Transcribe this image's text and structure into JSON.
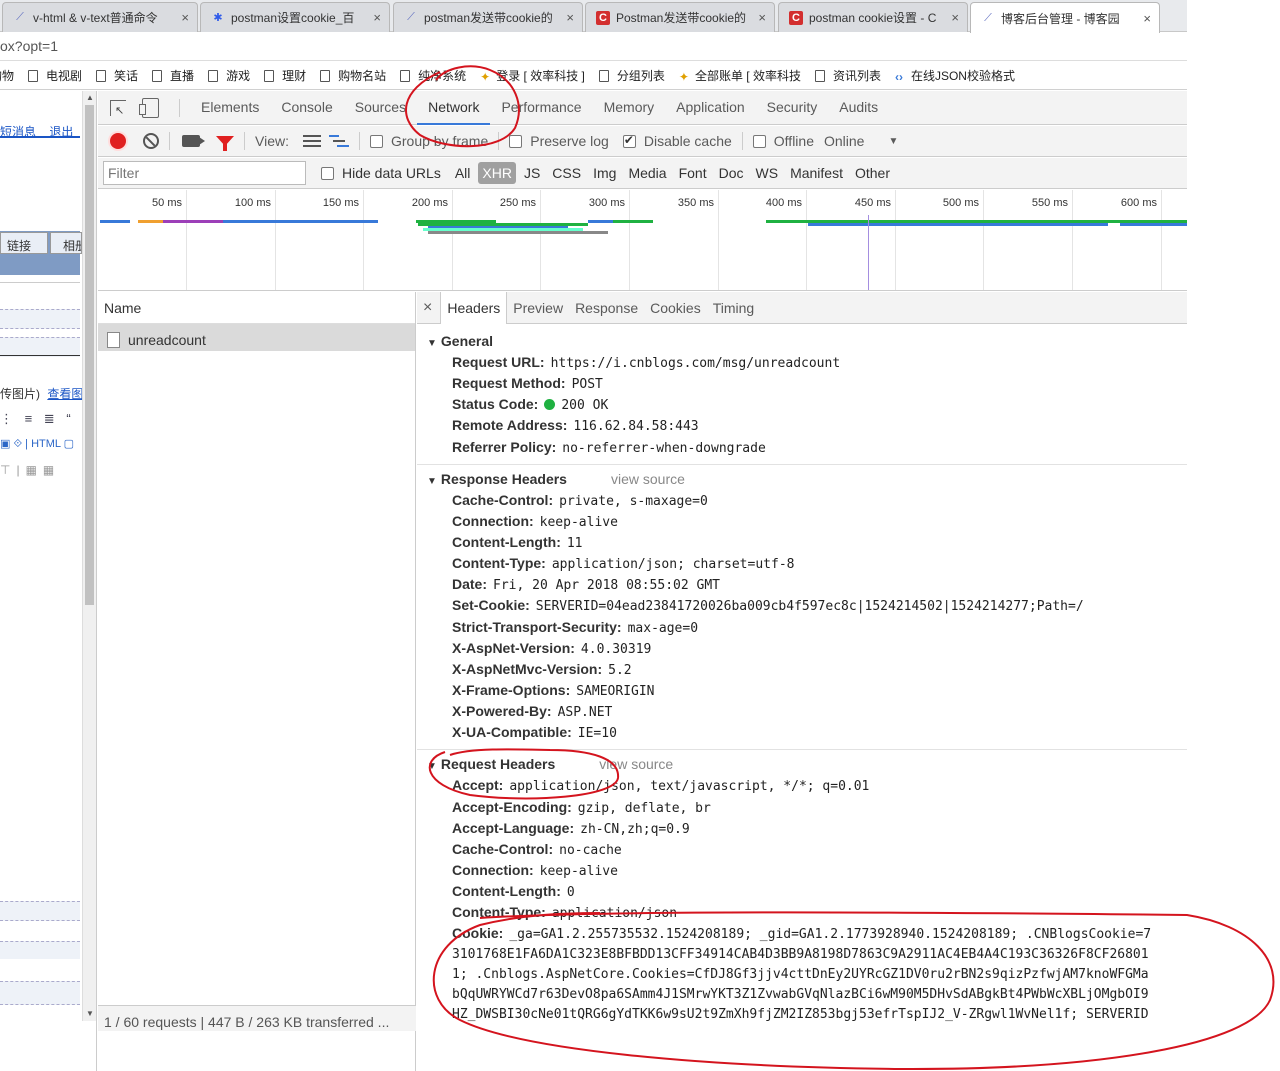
{
  "tabs": [
    {
      "title": "v-html & v-text普通命令",
      "icon": "ruler-icon",
      "icon_color": "#5c6bc0"
    },
    {
      "title": "postman设置cookie_百",
      "icon": "paw-icon",
      "icon_color": "#2f5bea"
    },
    {
      "title": "postman发送带cookie的",
      "icon": "ruler-icon",
      "icon_color": "#5c6bc0"
    },
    {
      "title": "Postman发送带cookie的",
      "icon": "c-logo-icon",
      "icon_color": "#d32f2f"
    },
    {
      "title": "postman cookie设置 - C",
      "icon": "c-logo-icon",
      "icon_color": "#d32f2f"
    },
    {
      "title": "博客后台管理 - 博客园",
      "icon": "ruler-icon",
      "icon_color": "#5c6bc0"
    }
  ],
  "address": "ox?opt=1",
  "bookmarks": [
    {
      "label": "购物",
      "icon": "page"
    },
    {
      "label": "电视剧",
      "icon": "page"
    },
    {
      "label": "笑话",
      "icon": "page"
    },
    {
      "label": "直播",
      "icon": "page"
    },
    {
      "label": "游戏",
      "icon": "page"
    },
    {
      "label": "理财",
      "icon": "page"
    },
    {
      "label": "购物名站",
      "icon": "page"
    },
    {
      "label": "纯净系统",
      "icon": "page"
    },
    {
      "label": "登录 [ 效率科技 ]",
      "icon": "star"
    },
    {
      "label": "分组列表",
      "icon": "page"
    },
    {
      "label": "全部账单 [ 效率科技",
      "icon": "star"
    },
    {
      "label": "资讯列表",
      "icon": "page"
    },
    {
      "label": "在线JSON校验格式",
      "icon": "code"
    }
  ],
  "left_panel": {
    "link1": "短消息",
    "link2": "退出",
    "tab1": "链接",
    "tab2": "相册",
    "upload": "传图片)",
    "view": "查看图"
  },
  "devtools": {
    "tabs": [
      "Elements",
      "Console",
      "Sources",
      "Network",
      "Performance",
      "Memory",
      "Application",
      "Security",
      "Audits"
    ],
    "active_tab": "Network",
    "toolbar": {
      "view": "View:",
      "group_by_frame": "Group by frame",
      "preserve_log": "Preserve log",
      "disable_cache": "Disable cache",
      "offline": "Offline",
      "online": "Online"
    },
    "filter": {
      "placeholder": "Filter",
      "hide_data_urls": "Hide data URLs",
      "types": [
        "All",
        "XHR",
        "JS",
        "CSS",
        "Img",
        "Media",
        "Font",
        "Doc",
        "WS",
        "Manifest",
        "Other"
      ],
      "active_type": "XHR"
    },
    "timeline_ticks": [
      "50 ms",
      "100 ms",
      "150 ms",
      "200 ms",
      "250 ms",
      "300 ms",
      "350 ms",
      "400 ms",
      "450 ms",
      "500 ms",
      "550 ms",
      "600 ms"
    ],
    "name_header": "Name",
    "request_name": "unreadcount",
    "status_bar": "1 / 60 requests  |  447 B / 263 KB transferred  ...",
    "detail_tabs": [
      "Headers",
      "Preview",
      "Response",
      "Cookies",
      "Timing"
    ],
    "active_detail_tab": "Headers",
    "close": "×",
    "view_source": "view source",
    "general": {
      "title": "General",
      "rows": [
        {
          "k": "Request URL:",
          "v": "https://i.cnblogs.com/msg/unreadcount"
        },
        {
          "k": "Request Method:",
          "v": "POST"
        },
        {
          "k": "Status Code:",
          "v": "200 OK"
        },
        {
          "k": "Remote Address:",
          "v": "116.62.84.58:443"
        },
        {
          "k": "Referrer Policy:",
          "v": "no-referrer-when-downgrade"
        }
      ]
    },
    "response_headers": {
      "title": "Response Headers",
      "rows": [
        {
          "k": "Cache-Control:",
          "v": "private, s-maxage=0"
        },
        {
          "k": "Connection:",
          "v": "keep-alive"
        },
        {
          "k": "Content-Length:",
          "v": "11"
        },
        {
          "k": "Content-Type:",
          "v": "application/json; charset=utf-8"
        },
        {
          "k": "Date:",
          "v": "Fri, 20 Apr 2018 08:55:02 GMT"
        },
        {
          "k": "Set-Cookie:",
          "v": "SERVERID=04ead23841720026ba009cb4f597ec8c|1524214502|1524214277;Path=/"
        },
        {
          "k": "Strict-Transport-Security:",
          "v": "max-age=0"
        },
        {
          "k": "X-AspNet-Version:",
          "v": "4.0.30319"
        },
        {
          "k": "X-AspNetMvc-Version:",
          "v": "5.2"
        },
        {
          "k": "X-Frame-Options:",
          "v": "SAMEORIGIN"
        },
        {
          "k": "X-Powered-By:",
          "v": "ASP.NET"
        },
        {
          "k": "X-UA-Compatible:",
          "v": "IE=10"
        }
      ]
    },
    "request_headers": {
      "title": "Request Headers",
      "rows": [
        {
          "k": "Accept:",
          "v": "application/json, text/javascript, */*; q=0.01"
        },
        {
          "k": "Accept-Encoding:",
          "v": "gzip, deflate, br"
        },
        {
          "k": "Accept-Language:",
          "v": "zh-CN,zh;q=0.9"
        },
        {
          "k": "Cache-Control:",
          "v": "no-cache"
        },
        {
          "k": "Connection:",
          "v": "keep-alive"
        },
        {
          "k": "Content-Length:",
          "v": "0"
        },
        {
          "k": "Content-Type:",
          "v": "application/json"
        }
      ],
      "cookie_key": "Cookie:",
      "cookie_lines": [
        "_ga=GA1.2.255735532.1524208189; _gid=GA1.2.1773928940.1524208189; .CNBlogsCookie=7",
        "3101768E1FA6DA1C323E8BFBDD13CFF34914CAB4D3BB9A8198D7863C9A2911AC4EB4A4C193C36326F8CF26801",
        "1; .Cnblogs.AspNetCore.Cookies=CfDJ8Gf3jjv4cttDnEy2UYRcGZ1DV0ru2rBN2s9qizPzfwjAM7knoWFGMa",
        "bQqUWRYWCd7r63DevO8pa6SAmm4J1SMrwYKT3Z1ZvwabGVqNlazBCi6wM90M5DHvSdABgkBt4PWbWcXBLjOMgbOI9",
        "HZ_DWSBI30cNe01tQRG6gYdTKK6w9sU2t9ZmXh9fjZM2IZ853bgj53efrTspIJ2_V-ZRgwl1WvNel1f; SERVERID"
      ]
    }
  },
  "colors": {
    "annotation_red": "#d4141e",
    "accent_blue": "#3879d9",
    "status_green": "#1fb141",
    "record_red": "#e02020"
  }
}
